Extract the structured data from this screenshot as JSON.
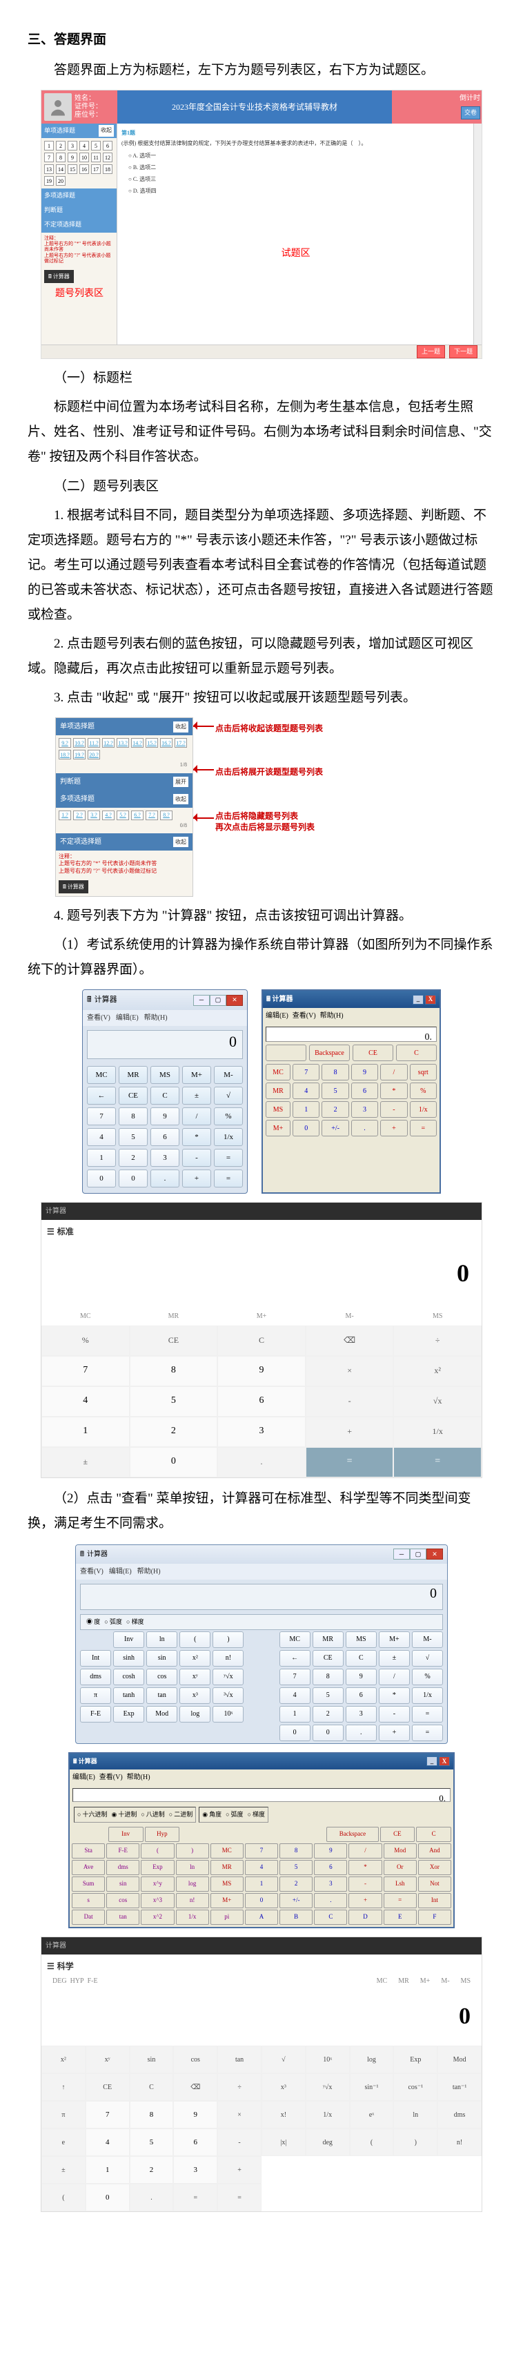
{
  "heading": "三、答题界面",
  "intro": "答题界面上方为标题栏，左下方为题号列表区，右下方为试题区。",
  "ss1": {
    "user": {
      "name": "姓名：",
      "id": "证件号：",
      "seat": "座位号："
    },
    "exam_title": "2023年度全国会计专业技术资格考试辅导教材",
    "right": {
      "timer_label": "倒计时",
      "btn_submit": "交卷"
    },
    "nav_groups": [
      "单项选择题",
      "多项选择题",
      "判断题",
      "不定项选择题"
    ],
    "nums": [
      "1",
      "2",
      "3",
      "4",
      "5",
      "6",
      "7",
      "8",
      "9",
      "10",
      "11",
      "12",
      "13",
      "14",
      "15",
      "16",
      "17",
      "18",
      "19",
      "20"
    ],
    "note": "注释：\n上题号右方的 \"*\" 号代表该小题尚未作答\n上题号右方的 \"?\" 号代表该小题做过标记",
    "calc_btn": "计算器",
    "qtitle": "第1题",
    "qbody": "(示例) 根据支付结算法律制度的规定，下列关于办理支付结算基本要求的表述中，不正确的是（　）。",
    "options": [
      "A. 选项一",
      "B. 选项二",
      "C. 选项三",
      "D. 选项四"
    ],
    "area_label_left": "题号列表区",
    "area_label_right": "试题区",
    "footer_prev": "上一题",
    "footer_next": "下一题"
  },
  "sec1_h": "（一）标题栏",
  "sec1_p": "标题栏中间位置为本场考试科目名称，左侧为考生基本信息，包括考生照片、姓名、性别、准考证号和证件号码。右侧为本场考试科目剩余时间信息、\"交卷\" 按钮及两个科目作答状态。",
  "sec2_h": "（二）题号列表区",
  "sec2_p1": "1. 根据考试科目不同，题目类型分为单项选择题、多项选择题、判断题、不定项选择题。题号右方的 \"*\" 号表示该小题还未作答，\"?\" 号表示该小题做过标记。考生可以通过题号列表查看本考试科目全套试卷的作答情况（包括每道试题的已答或未答状态、标记状态），还可点击各题号按钮，直接进入各试题进行答题或检查。",
  "sec2_p2": "2. 点击题号列表右侧的蓝色按钮，可以隐藏题号列表，增加试题区可视区域。隐藏后，再次点击此按钮可以重新显示题号列表。",
  "sec2_p3": "3. 点击 \"收起\" 或 \"展开\" 按钮可以收起或展开该题型题号列表。",
  "ss2": {
    "group1_h": "单项选择题",
    "group1_btn": "收起",
    "g1_nums": [
      "9.?",
      "10.?",
      "11.?",
      "12.?",
      "13.?",
      "14.?",
      "15.?",
      "16.?",
      "17.?",
      "18.?",
      "19.?",
      "20.?"
    ],
    "g1_cnt": "1/8",
    "group2_h": "判断题",
    "group2_btn": "展开",
    "group3_h": "多项选择题",
    "group3_btn": "收起",
    "g3_nums": [
      "1.?",
      "2.?",
      "3.?",
      "4.?",
      "5.?",
      "6.?",
      "7.?",
      "8.?"
    ],
    "g3_cnt": "0/8",
    "group4_h": "不定项选择题",
    "group4_btn": "收起",
    "note": "注释：\n上题号右方的 \"*\" 号代表该小题尚未作答\n上题号右方的 \"?\" 号代表该小题做过标记",
    "calc_btn": "计算器",
    "anno1": "点击后将收起该题型题号列表",
    "anno2": "点击后将展开该题型题号列表",
    "anno3a": "点击后将隐藏题号列表",
    "anno3b": "再次点击后将显示题号列表"
  },
  "sec2_p4": "4. 题号列表下方为 \"计算器\" 按钮，点击该按钮可调出计算器。",
  "sec2_p4a": "（1）考试系统使用的计算器为操作系统自带计算器（如图所列为不同操作系统下的计算器界面）。",
  "win7": {
    "title": "计算器",
    "menu_v": "查看(V)",
    "menu_e": "编辑(E)",
    "menu_h": "帮助(H)",
    "disp": "0",
    "keys": [
      [
        "MC",
        "MR",
        "MS",
        "M+",
        "M-"
      ],
      [
        "←",
        "CE",
        "C",
        "±",
        "√"
      ],
      [
        "7",
        "8",
        "9",
        "/",
        "%"
      ],
      [
        "4",
        "5",
        "6",
        "*",
        "1/x"
      ],
      [
        "1",
        "2",
        "3",
        "-",
        "="
      ],
      [
        "0",
        "0",
        ".",
        "+",
        "="
      ]
    ]
  },
  "xp": {
    "title": "计算器",
    "menu_e": "编辑(E)",
    "menu_v": "查看(V)",
    "menu_h": "帮助(H)",
    "disp": "0.",
    "top_btns": [
      "",
      "Backspace",
      "CE",
      "C"
    ],
    "keys": [
      [
        "MC",
        "7",
        "8",
        "9",
        "/",
        "sqrt"
      ],
      [
        "MR",
        "4",
        "5",
        "6",
        "*",
        "%"
      ],
      [
        "MS",
        "1",
        "2",
        "3",
        "-",
        "1/x"
      ],
      [
        "M+",
        "0",
        "+/-",
        ".",
        "+",
        "="
      ]
    ]
  },
  "calc3": {
    "titlebar": "计算器",
    "tab": "标准",
    "disp": "0",
    "mem": [
      "MC",
      "MR",
      "M+",
      "M-",
      "MS"
    ],
    "grid": [
      [
        "%",
        "CE",
        "C",
        "⌫",
        "÷"
      ],
      [
        "7",
        "8",
        "9",
        "×",
        "x²"
      ],
      [
        "4",
        "5",
        "6",
        "-",
        "√x"
      ],
      [
        "1",
        "2",
        "3",
        "+",
        "1/x"
      ],
      [
        "±",
        "0",
        ".",
        "=",
        "="
      ]
    ]
  },
  "sec2_p5": "（2）点击 \"查看\" 菜单按钮，计算器可在标准型、科学型等不同类型间变换，满足考生不同需求。",
  "c4": {
    "title": "计算器",
    "menu_v": "查看(V)",
    "menu_e": "编辑(E)",
    "menu_h": "帮助(H)",
    "disp": "0",
    "angle": [
      "度",
      "弧度",
      "梯度"
    ],
    "rows": [
      [
        "",
        "Inv",
        "ln",
        "(",
        ")",
        "",
        "MC",
        "MR",
        "MS",
        "M+",
        "M-"
      ],
      [
        "Int",
        "sinh",
        "sin",
        "x²",
        "n!",
        "",
        "←",
        "CE",
        "C",
        "±",
        "√"
      ],
      [
        "dms",
        "cosh",
        "cos",
        "xʸ",
        "ʸ√x",
        "",
        "7",
        "8",
        "9",
        "/",
        "%"
      ],
      [
        "π",
        "tanh",
        "tan",
        "x³",
        "³√x",
        "",
        "4",
        "5",
        "6",
        "*",
        "1/x"
      ],
      [
        "F-E",
        "Exp",
        "Mod",
        "log",
        "10ˣ",
        "",
        "1",
        "2",
        "3",
        "-",
        "="
      ],
      [
        "",
        "",
        "",
        "",
        "",
        "",
        "0",
        "0",
        ".",
        "+",
        "="
      ]
    ]
  },
  "c5": {
    "title": "计算器",
    "menu_e": "编辑(E)",
    "menu_v": "查看(V)",
    "menu_h": "帮助(H)",
    "disp": "0.",
    "radio1": [
      "十六进制",
      "十进制",
      "八进制",
      "二进制"
    ],
    "radio2": [
      "角度",
      "弧度",
      "梯度"
    ],
    "top": [
      "",
      "",
      "",
      "",
      "Backspace",
      "CE",
      "C"
    ],
    "rows": [
      [
        "Sta",
        "F-E",
        "(",
        ")",
        "MC",
        "7",
        "8",
        "9",
        "/",
        "Mod",
        "And"
      ],
      [
        "Ave",
        "dms",
        "Exp",
        "ln",
        "MR",
        "4",
        "5",
        "6",
        "*",
        "Or",
        "Xor"
      ],
      [
        "Sum",
        "sin",
        "x^y",
        "log",
        "MS",
        "1",
        "2",
        "3",
        "-",
        "Lsh",
        "Not"
      ],
      [
        "s",
        "cos",
        "x^3",
        "n!",
        "M+",
        "0",
        "+/-",
        ".",
        "+",
        "=",
        "Int"
      ],
      [
        "Dat",
        "tan",
        "x^2",
        "1/x",
        "pi",
        "A",
        "B",
        "C",
        "D",
        "E",
        "F"
      ]
    ]
  },
  "c6": {
    "titlebar": "计算器",
    "tab": "科学",
    "disp": "0",
    "deg": "DEG",
    "hyp": "HYP",
    "fe": "F-E",
    "mem": [
      "MC",
      "MR",
      "M+",
      "M-",
      "MS"
    ],
    "rows": [
      [
        "x²",
        "xʸ",
        "sin",
        "cos",
        "tan",
        "√",
        "10ˣ",
        "log",
        "Exp",
        "Mod"
      ],
      [
        "↑",
        "CE",
        "C",
        "⌫",
        "÷",
        "x³",
        "ʸ√x",
        "sin⁻¹",
        "cos⁻¹",
        "tan⁻¹"
      ],
      [
        "π",
        "7",
        "8",
        "9",
        "×",
        "x!",
        "1/x",
        "eˣ",
        "ln",
        "dms"
      ],
      [
        "e",
        "4",
        "5",
        "6",
        "-",
        "|x|",
        "deg",
        "(",
        ")",
        "n!"
      ],
      [
        "±",
        "1",
        "2",
        "3",
        "+",
        "",
        "",
        "",
        "",
        ""
      ],
      [
        "(",
        "0",
        ".",
        "=",
        "=",
        "",
        "",
        "",
        "",
        ""
      ]
    ]
  }
}
